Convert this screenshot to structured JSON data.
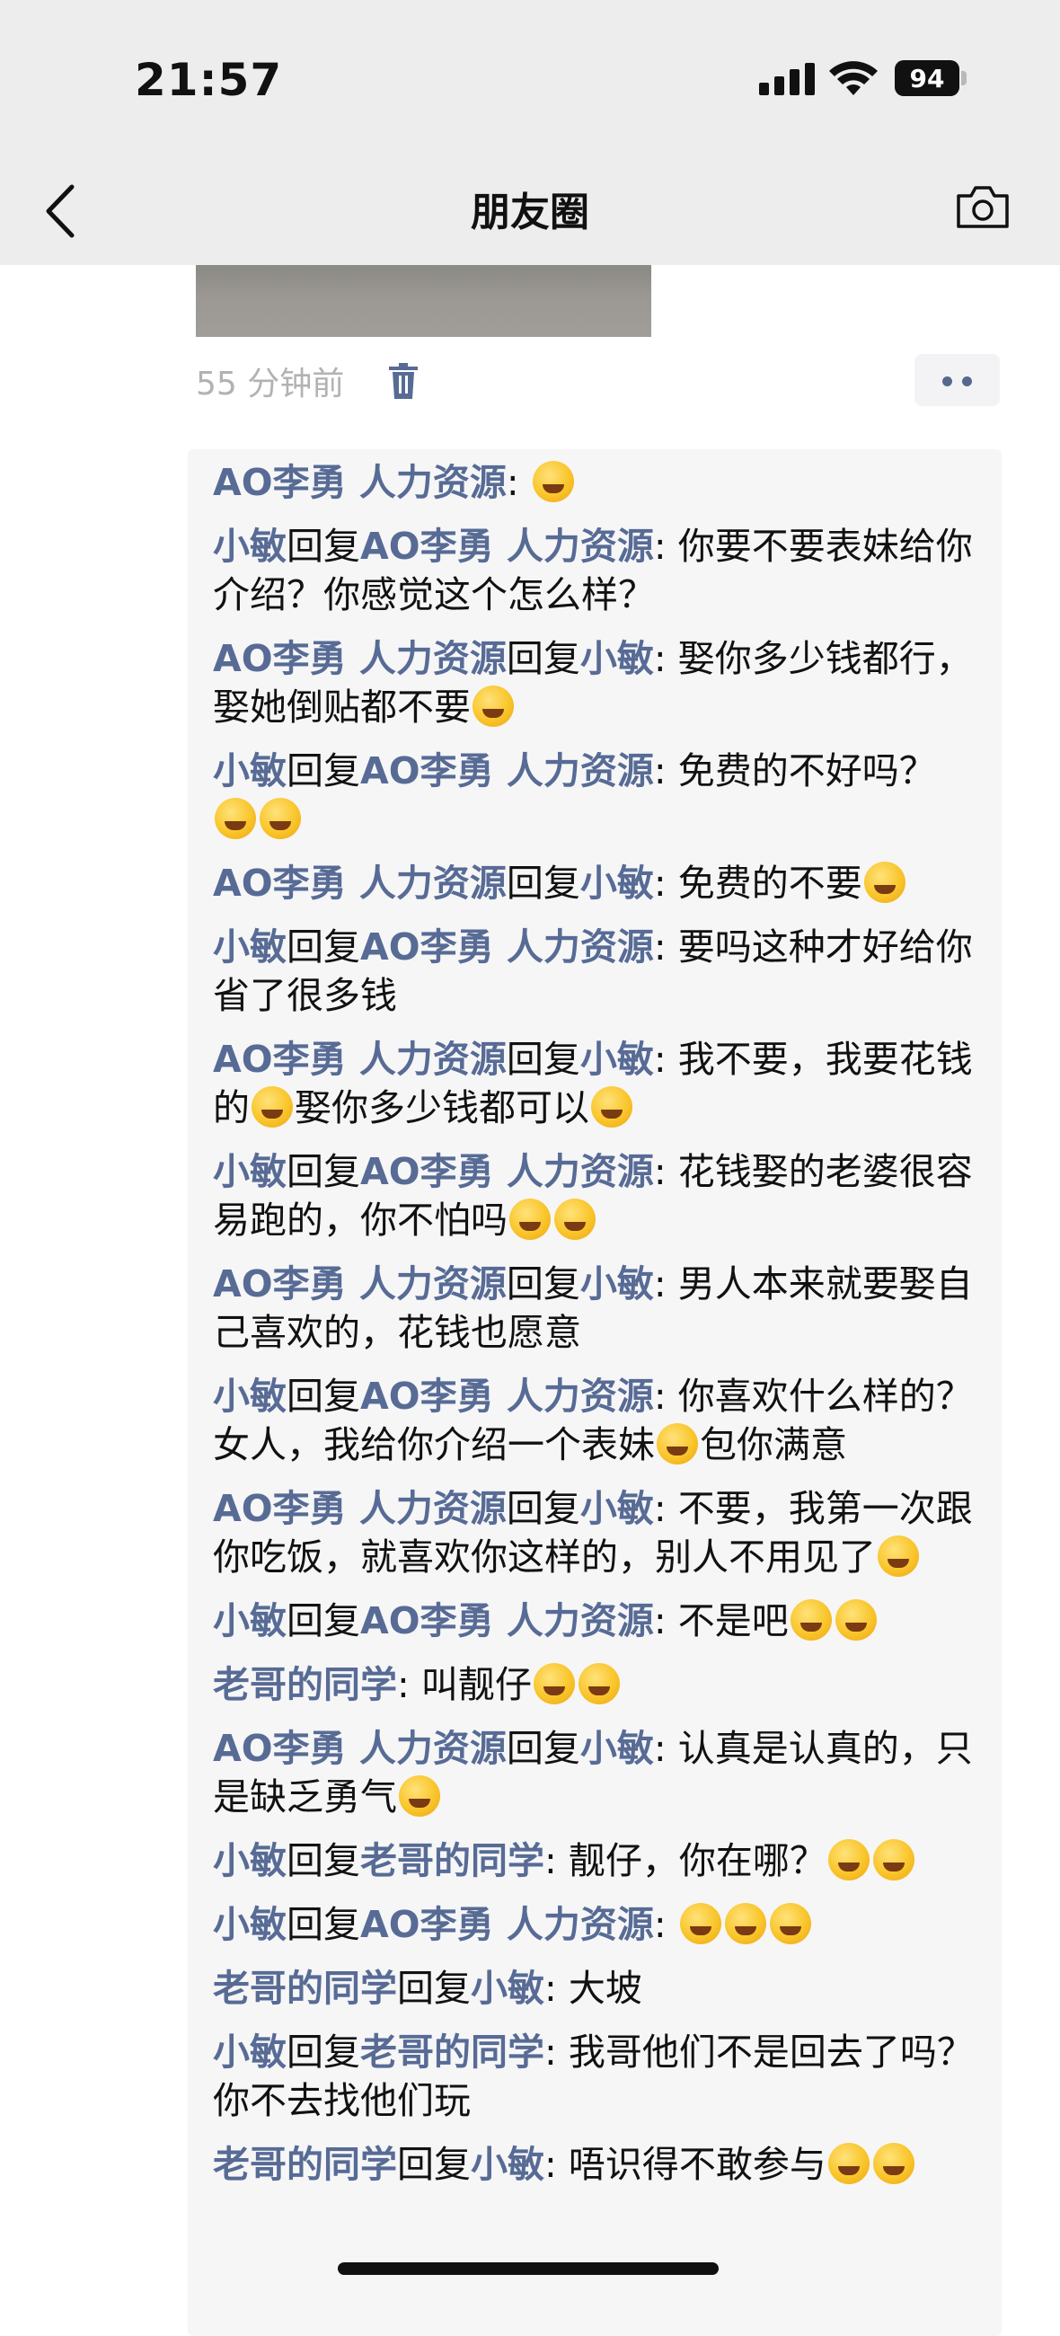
{
  "status_bar": {
    "time": "21:57",
    "battery": "94"
  },
  "nav": {
    "title": "朋友圈"
  },
  "post": {
    "time_ago": "55 分钟前"
  },
  "comments": [
    {
      "from": "AO李勇  人力资源",
      "to": "",
      "text": "",
      "emoji_after": 1
    },
    {
      "from": "小敏",
      "to": "AO李勇  人力资源",
      "text": "你要不要表妹给你介绍？你感觉这个怎么样？",
      "emoji_after": 0
    },
    {
      "from": "AO李勇  人力资源",
      "to": "小敏",
      "text": "娶你多少钱都行，娶她倒贴都不要",
      "emoji_after": 1
    },
    {
      "from": "小敏",
      "to": "AO李勇  人力资源",
      "text": "免费的不好吗？",
      "emoji_after": 2
    },
    {
      "from": "AO李勇  人力资源",
      "to": "小敏",
      "text": "免费的不要",
      "emoji_after": 1
    },
    {
      "from": "小敏",
      "to": "AO李勇  人力资源",
      "text": "要吗这种才好给你省了很多钱",
      "emoji_after": 0
    },
    {
      "from": "AO李勇  人力资源",
      "to": "小敏",
      "text": "我不要，我要花钱的",
      "text2": "娶你多少钱都可以",
      "emoji_after": 1
    },
    {
      "from": "小敏",
      "to": "AO李勇  人力资源",
      "text": "花钱娶的老婆很容易跑的，你不怕吗",
      "emoji_after": 2
    },
    {
      "from": "AO李勇  人力资源",
      "to": "小敏",
      "text": "男人本来就要娶自己喜欢的，花钱也愿意",
      "emoji_after": 0
    },
    {
      "from": "小敏",
      "to": "AO李勇  人力资源",
      "text": "你喜欢什么样的？女人，我给你介绍一个表妹",
      "text2": "包你满意",
      "emoji_after": 0
    },
    {
      "from": "AO李勇  人力资源",
      "to": "小敏",
      "text": "不要，我第一次跟你吃饭，就喜欢你这样的，别人不用见了",
      "emoji_after": 1
    },
    {
      "from": "小敏",
      "to": "AO李勇  人力资源",
      "text": "不是吧",
      "emoji_after": 2
    },
    {
      "from": "老哥的同学",
      "to": "",
      "text": "叫靓仔",
      "emoji_after": 2
    },
    {
      "from": "AO李勇  人力资源",
      "to": "小敏",
      "text": "认真是认真的，只是缺乏勇气",
      "emoji_after": 1
    },
    {
      "from": "小敏",
      "to": "老哥的同学",
      "text": "靓仔，你在哪？",
      "emoji_after": 2
    },
    {
      "from": "小敏",
      "to": "AO李勇  人力资源",
      "text": "",
      "emoji_after": 3
    },
    {
      "from": "老哥的同学",
      "to": "小敏",
      "text": "大坡",
      "emoji_after": 0
    },
    {
      "from": "小敏",
      "to": "老哥的同学",
      "text": "我哥他们不是回去了吗？你不去找他们玩",
      "emoji_after": 0
    },
    {
      "from": "老哥的同学",
      "to": "小敏",
      "text": "唔识得不敢参与",
      "emoji_after": 2
    }
  ],
  "reply_word": "回复",
  "colon": ": ",
  "colors": {
    "name": "#576b95",
    "bar": "#ededed",
    "comment_bg": "#f6f6f7"
  },
  "icons": [
    "back-chevron-icon",
    "camera-icon",
    "trash-icon",
    "more-dots-icon",
    "signal-icon",
    "wifi-icon",
    "battery-icon"
  ]
}
